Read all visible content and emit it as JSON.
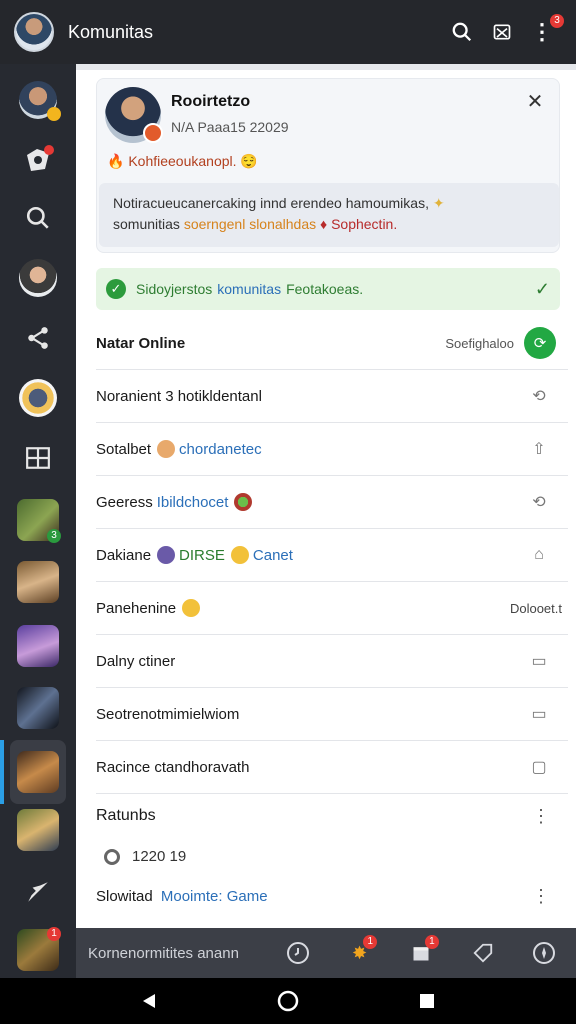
{
  "appbar": {
    "title": "Komunitas",
    "notification_badge": "3"
  },
  "rail": {
    "items": [
      {
        "name": "rail-avatar-profile",
        "badge": ""
      },
      {
        "name": "rail-community-icon",
        "badge": ""
      },
      {
        "name": "rail-search-icon",
        "badge": ""
      },
      {
        "name": "rail-avatar-friend",
        "badge": ""
      },
      {
        "name": "rail-share-icon",
        "badge": ""
      },
      {
        "name": "rail-avatar-bot",
        "badge": ""
      },
      {
        "name": "rail-grid-icon",
        "badge": ""
      },
      {
        "name": "rail-game-1",
        "badge": "3"
      },
      {
        "name": "rail-game-2",
        "badge": ""
      },
      {
        "name": "rail-game-3",
        "badge": ""
      },
      {
        "name": "rail-game-4",
        "badge": ""
      },
      {
        "name": "rail-game-5",
        "badge": ""
      },
      {
        "name": "rail-game-6",
        "badge": ""
      },
      {
        "name": "rail-rocket-icon",
        "badge": ""
      },
      {
        "name": "rail-game-7",
        "badge": "1"
      }
    ]
  },
  "profile": {
    "name": "Rooirtetzo",
    "subtitle": "N/A Paaa15 22029",
    "status": "Kohfieeoukanopl.",
    "note_part1": "Notiracueucanercaking innd erendeo hamoumikas,",
    "note_part2": "somunitias",
    "note_part3": "soerngenl slonalhdas",
    "note_part4": "Sophectin."
  },
  "banner": {
    "text1": "Sidoyjerstos",
    "text2": "komunitas",
    "text3": "Feotakoeas."
  },
  "rows": [
    {
      "label": "Natar Online",
      "extra": "",
      "right_text": "Soefighaloo"
    },
    {
      "label": "Noranient 3 hotikldentanl",
      "extra": "",
      "right_text": ""
    },
    {
      "label": "Sotalbet",
      "extra": "chordanetec",
      "right_text": ""
    },
    {
      "label": "Geeress",
      "extra": "Ibildchocet",
      "right_text": ""
    },
    {
      "label": "Dakiane",
      "extra": "DIRSE",
      "extra2": "Canet",
      "right_text": ""
    },
    {
      "label": "Panehenine",
      "extra": "",
      "right_text": "Dolooet.t"
    },
    {
      "label": "Dalny ctiner",
      "extra": "",
      "right_text": ""
    },
    {
      "label": "Seotrenotmimielwiom",
      "extra": "",
      "right_text": ""
    },
    {
      "label": "Racince ctandhoravath",
      "extra": "",
      "right_text": ""
    }
  ],
  "section": {
    "title": "Ratunbs",
    "counter": "1220 19",
    "slow_label": "Slowitad",
    "slow_link": "Mooimte: Game"
  },
  "bottombar": {
    "placeholder": "Kornenormitites anann",
    "badge_a": "1",
    "badge_b": "1"
  },
  "colors": {
    "accent_blue": "#2b6fb8",
    "online_green": "#22a843",
    "banner_bg": "#e5f5e3"
  }
}
